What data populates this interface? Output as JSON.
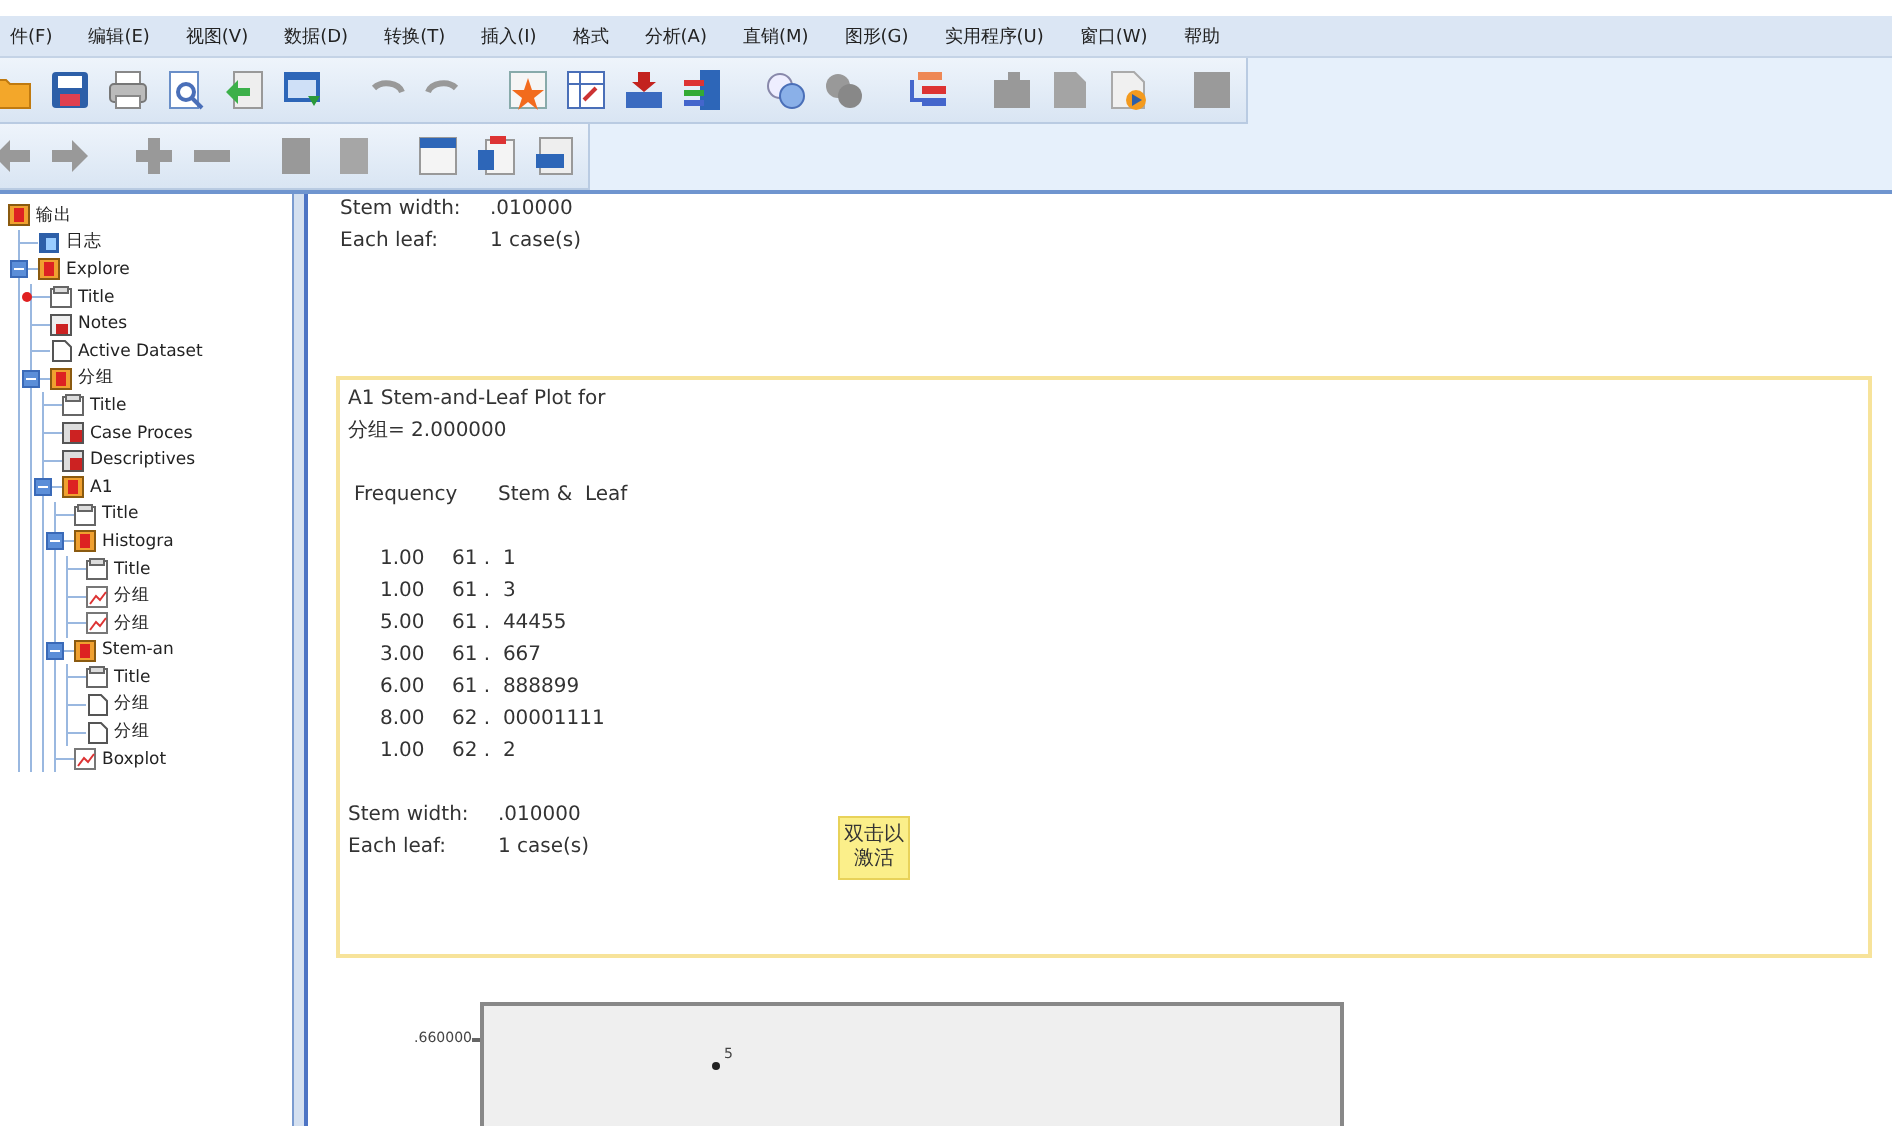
{
  "menu": [
    "件(F)",
    "编辑(E)",
    "视图(V)",
    "数据(D)",
    "转换(T)",
    "插入(I)",
    "格式",
    "分析(A)",
    "直销(M)",
    "图形(G)",
    "实用程序(U)",
    "窗口(W)",
    "帮助"
  ],
  "tree": [
    {
      "label": "输出",
      "kind": "output",
      "current": false,
      "children": [
        {
          "label": "日志",
          "kind": "log",
          "current": false
        },
        {
          "label": "Explore",
          "kind": "output",
          "current": false,
          "expanded": true,
          "children": [
            {
              "label": "Title",
              "kind": "title",
              "current": true
            },
            {
              "label": "Notes",
              "kind": "notes",
              "current": false
            },
            {
              "label": "Active Dataset",
              "kind": "text",
              "current": false
            },
            {
              "label": "分组",
              "kind": "output",
              "current": false,
              "expanded": true,
              "children": [
                {
                  "label": "Title",
                  "kind": "title",
                  "current": false
                },
                {
                  "label": "Case Proces",
                  "kind": "table",
                  "current": false
                },
                {
                  "label": "Descriptives",
                  "kind": "table",
                  "current": false
                },
                {
                  "label": "A1",
                  "kind": "output",
                  "current": false,
                  "expanded": true,
                  "children": [
                    {
                      "label": "Title",
                      "kind": "title",
                      "current": false
                    },
                    {
                      "label": "Histogra",
                      "kind": "output",
                      "current": false,
                      "expanded": true,
                      "children": [
                        {
                          "label": "Title",
                          "kind": "title",
                          "current": false
                        },
                        {
                          "label": "分组",
                          "kind": "chart",
                          "current": false
                        },
                        {
                          "label": "分组",
                          "kind": "chart",
                          "current": false
                        }
                      ]
                    },
                    {
                      "label": "Stem-an",
                      "kind": "output",
                      "current": false,
                      "expanded": true,
                      "children": [
                        {
                          "label": "Title",
                          "kind": "title",
                          "current": false
                        },
                        {
                          "label": "分组",
                          "kind": "text",
                          "current": false
                        },
                        {
                          "label": "分组",
                          "kind": "text",
                          "current": false
                        }
                      ]
                    },
                    {
                      "label": "Boxplot",
                      "kind": "chart",
                      "current": false
                    }
                  ]
                }
              ]
            }
          ]
        }
      ]
    }
  ],
  "output": {
    "previous_footer": {
      "stem_width_label": "Stem width:",
      "stem_width": ".010000",
      "each_leaf_label": "Each leaf:",
      "each_leaf": "1 case(s)"
    },
    "stem_leaf_plot": {
      "title": "A1 Stem-and-Leaf Plot for",
      "group": "分组= 2.000000",
      "columns": [
        "Frequency",
        "Stem &  Leaf"
      ],
      "rows": [
        {
          "frequency": "1.00",
          "stem_leaf": "61 .  1"
        },
        {
          "frequency": "1.00",
          "stem_leaf": "61 .  3"
        },
        {
          "frequency": "5.00",
          "stem_leaf": "61 .  44455"
        },
        {
          "frequency": "3.00",
          "stem_leaf": "61 .  667"
        },
        {
          "frequency": "6.00",
          "stem_leaf": "61 .  888899"
        },
        {
          "frequency": "8.00",
          "stem_leaf": "62 .  00001111"
        },
        {
          "frequency": "1.00",
          "stem_leaf": "62 .  2"
        }
      ],
      "stem_width_label": "Stem width:",
      "stem_width": ".010000",
      "each_leaf_label": "Each leaf:",
      "each_leaf": "1 case(s)",
      "activate_hint": "双击以激活"
    },
    "boxplot": {
      "y_tick_label": ".660000",
      "outlier_label": "5"
    }
  }
}
